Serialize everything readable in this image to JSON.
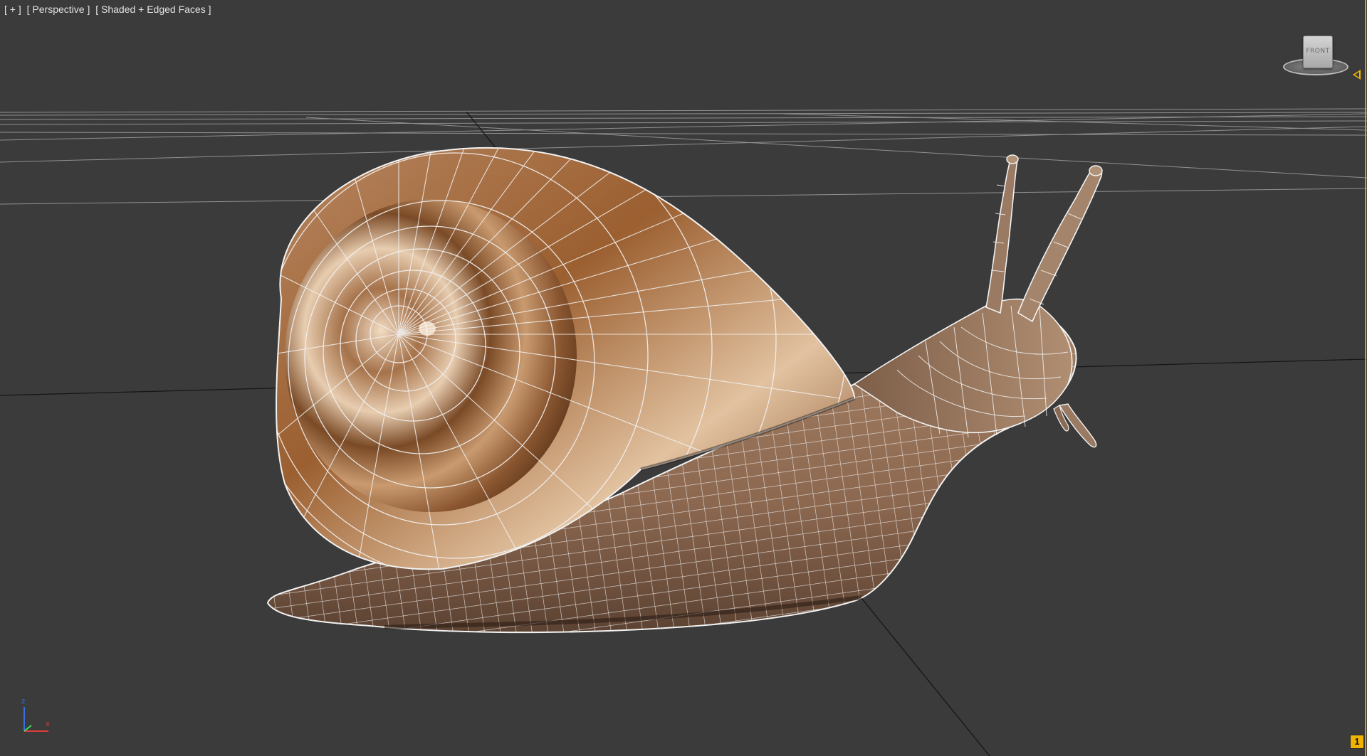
{
  "viewport": {
    "menu_label": "[ + ]",
    "view_label": "[ Perspective ]",
    "shading_label": "[ Shaded + Edged Faces ]"
  },
  "viewcube": {
    "face_label": "FRONT"
  },
  "axis_tripod": {
    "z_label": "z",
    "x_label": "x"
  },
  "time_slider": {
    "frame": "1"
  },
  "colors": {
    "viewport_bg": "#3b3b3b",
    "grid_line": "#9a9a9a",
    "axis_line": "#1a1a1a",
    "mesh_wire": "#f2f2f2",
    "shell_dark": "#6b3e1c",
    "shell_mid": "#a5724a",
    "shell_light": "#d9b18a",
    "body": "#8f6c53",
    "time_slider": "#f0b400",
    "axis_z": "#3b6fe0",
    "axis_x": "#e03b3b",
    "axis_y": "#3be05a"
  }
}
